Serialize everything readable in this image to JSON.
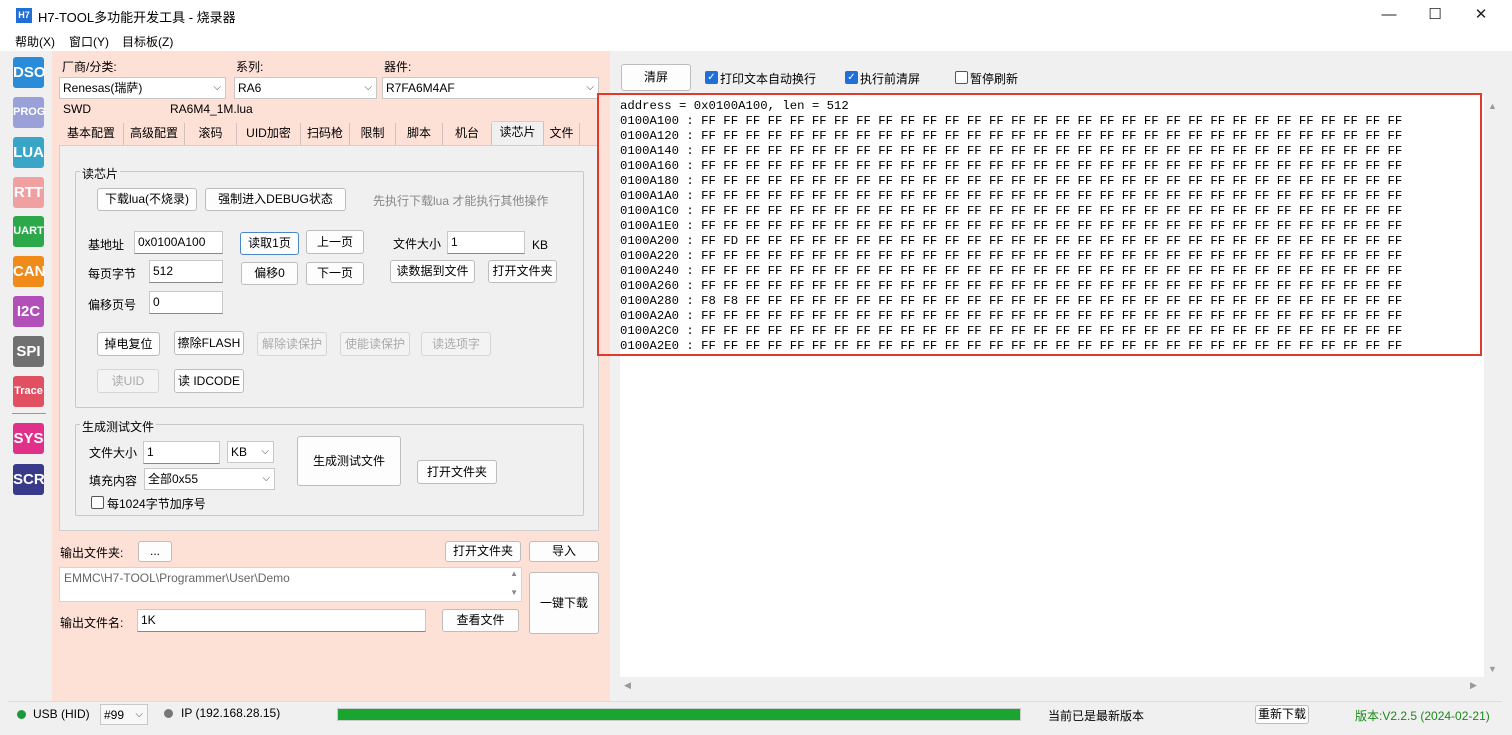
{
  "window": {
    "title": "H7-TOOL多功能开发工具 - 烧录器",
    "app_icon": "H7",
    "minimize": "—",
    "maximize": "☐",
    "close": "✕"
  },
  "menu": [
    "帮助(X)",
    "窗口(Y)",
    "目标板(Z)"
  ],
  "left_bar": [
    {
      "label": "DSO",
      "color": "#2a8bd8"
    },
    {
      "label": "PROG",
      "color": "#9aa0d8"
    },
    {
      "label": "LUA",
      "color": "#39a6c8"
    },
    {
      "label": "RTT",
      "color": "#f0a0a0"
    },
    {
      "label": "UART",
      "color": "#2aa84a"
    },
    {
      "label": "CAN",
      "color": "#f08a1a"
    },
    {
      "label": "I2C",
      "color": "#b050b8"
    },
    {
      "label": "SPI",
      "color": "#707070"
    },
    {
      "label": "Trace",
      "color": "#e05060"
    },
    {
      "label": "SYS",
      "color": "#e0308a"
    },
    {
      "label": "SCR",
      "color": "#3a3a8a"
    }
  ],
  "top": {
    "vendor_label": "厂商/分类:",
    "vendor_value": "Renesas(瑞萨)",
    "series_label": "系列:",
    "series_value": "RA6",
    "device_label": "器件:",
    "device_value": "R7FA6M4AF",
    "interface": "SWD",
    "lua_file": "RA6M4_1M.lua"
  },
  "tabs": [
    "基本配置",
    "高级配置",
    "滚码",
    "UID加密",
    "扫码枪",
    "限制",
    "脚本",
    "机台",
    "读芯片",
    "文件"
  ],
  "active_tab": "读芯片",
  "read_chip": {
    "group_title": "读芯片",
    "download_lua_btn": "下载lua(不烧录)",
    "force_debug_btn": "强制进入DEBUG状态",
    "hint": "先执行下载lua 才能执行其他操作",
    "base_addr_label": "基地址",
    "base_addr_value": "0x0100A100",
    "read_page_btn": "读取1页",
    "prev_page_btn": "上一页",
    "file_size_label": "文件大小",
    "file_size_value": "1",
    "file_size_unit": "KB",
    "bytes_per_page_label": "每页字节",
    "bytes_per_page_value": "512",
    "offset0_btn": "偏移0",
    "next_page_btn": "下一页",
    "read_to_file_btn": "读数据到文件",
    "open_folder_btn": "打开文件夹",
    "offset_page_label": "偏移页号",
    "offset_page_value": "0",
    "power_reset_btn": "掉电复位",
    "erase_flash_btn": "擦除FLASH",
    "unlock_read_btn": "解除读保护",
    "enable_read_btn": "使能读保护",
    "read_option_btn": "读选项字",
    "read_uid_btn": "读UID",
    "read_idcode_btn": "读 IDCODE"
  },
  "gen_test": {
    "group_title": "生成测试文件",
    "file_size_label": "文件大小",
    "file_size_value": "1",
    "unit_value": "KB",
    "fill_label": "填充内容",
    "fill_value": "全部0x55",
    "generate_btn": "生成测试文件",
    "open_folder_btn": "打开文件夹",
    "add_seq_label": "每1024字节加序号"
  },
  "output": {
    "folder_label": "输出文件夹:",
    "browse_btn": "...",
    "open_folder_btn": "打开文件夹",
    "import_btn": "导入",
    "path": "EMMC\\H7-TOOL\\Programmer\\User\\Demo",
    "one_key_btn": "一键下载",
    "filename_label": "输出文件名:",
    "filename_value": "1K",
    "view_file_btn": "查看文件"
  },
  "right_toolbar": {
    "clear_btn": "清屏",
    "auto_wrap_label": "打印文本自动换行",
    "auto_wrap_checked": true,
    "clear_before_label": "执行前清屏",
    "clear_before_checked": true,
    "pause_label": "暂停刷新",
    "pause_checked": false
  },
  "hex_dump": [
    "address = 0x0100A100, len = 512",
    "0100A100 : FF FF FF FF FF FF FF FF FF FF FF FF FF FF FF FF FF FF FF FF FF FF FF FF FF FF FF FF FF FF FF FF",
    "0100A120 : FF FF FF FF FF FF FF FF FF FF FF FF FF FF FF FF FF FF FF FF FF FF FF FF FF FF FF FF FF FF FF FF",
    "0100A140 : FF FF FF FF FF FF FF FF FF FF FF FF FF FF FF FF FF FF FF FF FF FF FF FF FF FF FF FF FF FF FF FF",
    "0100A160 : FF FF FF FF FF FF FF FF FF FF FF FF FF FF FF FF FF FF FF FF FF FF FF FF FF FF FF FF FF FF FF FF",
    "0100A180 : FF FF FF FF FF FF FF FF FF FF FF FF FF FF FF FF FF FF FF FF FF FF FF FF FF FF FF FF FF FF FF FF",
    "0100A1A0 : FF FF FF FF FF FF FF FF FF FF FF FF FF FF FF FF FF FF FF FF FF FF FF FF FF FF FF FF FF FF FF FF",
    "0100A1C0 : FF FF FF FF FF FF FF FF FF FF FF FF FF FF FF FF FF FF FF FF FF FF FF FF FF FF FF FF FF FF FF FF",
    "0100A1E0 : FF FF FF FF FF FF FF FF FF FF FF FF FF FF FF FF FF FF FF FF FF FF FF FF FF FF FF FF FF FF FF FF",
    "0100A200 : FF FD FF FF FF FF FF FF FF FF FF FF FF FF FF FF FF FF FF FF FF FF FF FF FF FF FF FF FF FF FF FF",
    "0100A220 : FF FF FF FF FF FF FF FF FF FF FF FF FF FF FF FF FF FF FF FF FF FF FF FF FF FF FF FF FF FF FF FF",
    "0100A240 : FF FF FF FF FF FF FF FF FF FF FF FF FF FF FF FF FF FF FF FF FF FF FF FF FF FF FF FF FF FF FF FF",
    "0100A260 : FF FF FF FF FF FF FF FF FF FF FF FF FF FF FF FF FF FF FF FF FF FF FF FF FF FF FF FF FF FF FF FF",
    "0100A280 : F8 F8 FF FF FF FF FF FF FF FF FF FF FF FF FF FF FF FF FF FF FF FF FF FF FF FF FF FF FF FF FF FF",
    "0100A2A0 : FF FF FF FF FF FF FF FF FF FF FF FF FF FF FF FF FF FF FF FF FF FF FF FF FF FF FF FF FF FF FF FF",
    "0100A2C0 : FF FF FF FF FF FF FF FF FF FF FF FF FF FF FF FF FF FF FF FF FF FF FF FF FF FF FF FF FF FF FF FF",
    "0100A2E0 : FF FF FF FF FF FF FF FF FF FF FF FF FF FF FF FF FF FF FF FF FF FF FF FF FF FF FF FF FF FF FF FF"
  ],
  "status": {
    "usb": "USB (HID)",
    "usb_dot_color": "#1a9a3a",
    "device_no": "#99",
    "ip": "IP (192.168.28.15)",
    "ip_dot_color": "#777777",
    "progress": 1.0,
    "progress_color": "#1aa531",
    "update_text": "当前已是最新版本",
    "redownload_btn": "重新下载",
    "version": "版本:V2.2.5 (2024-02-21)",
    "version_color": "#1a8a1a"
  }
}
